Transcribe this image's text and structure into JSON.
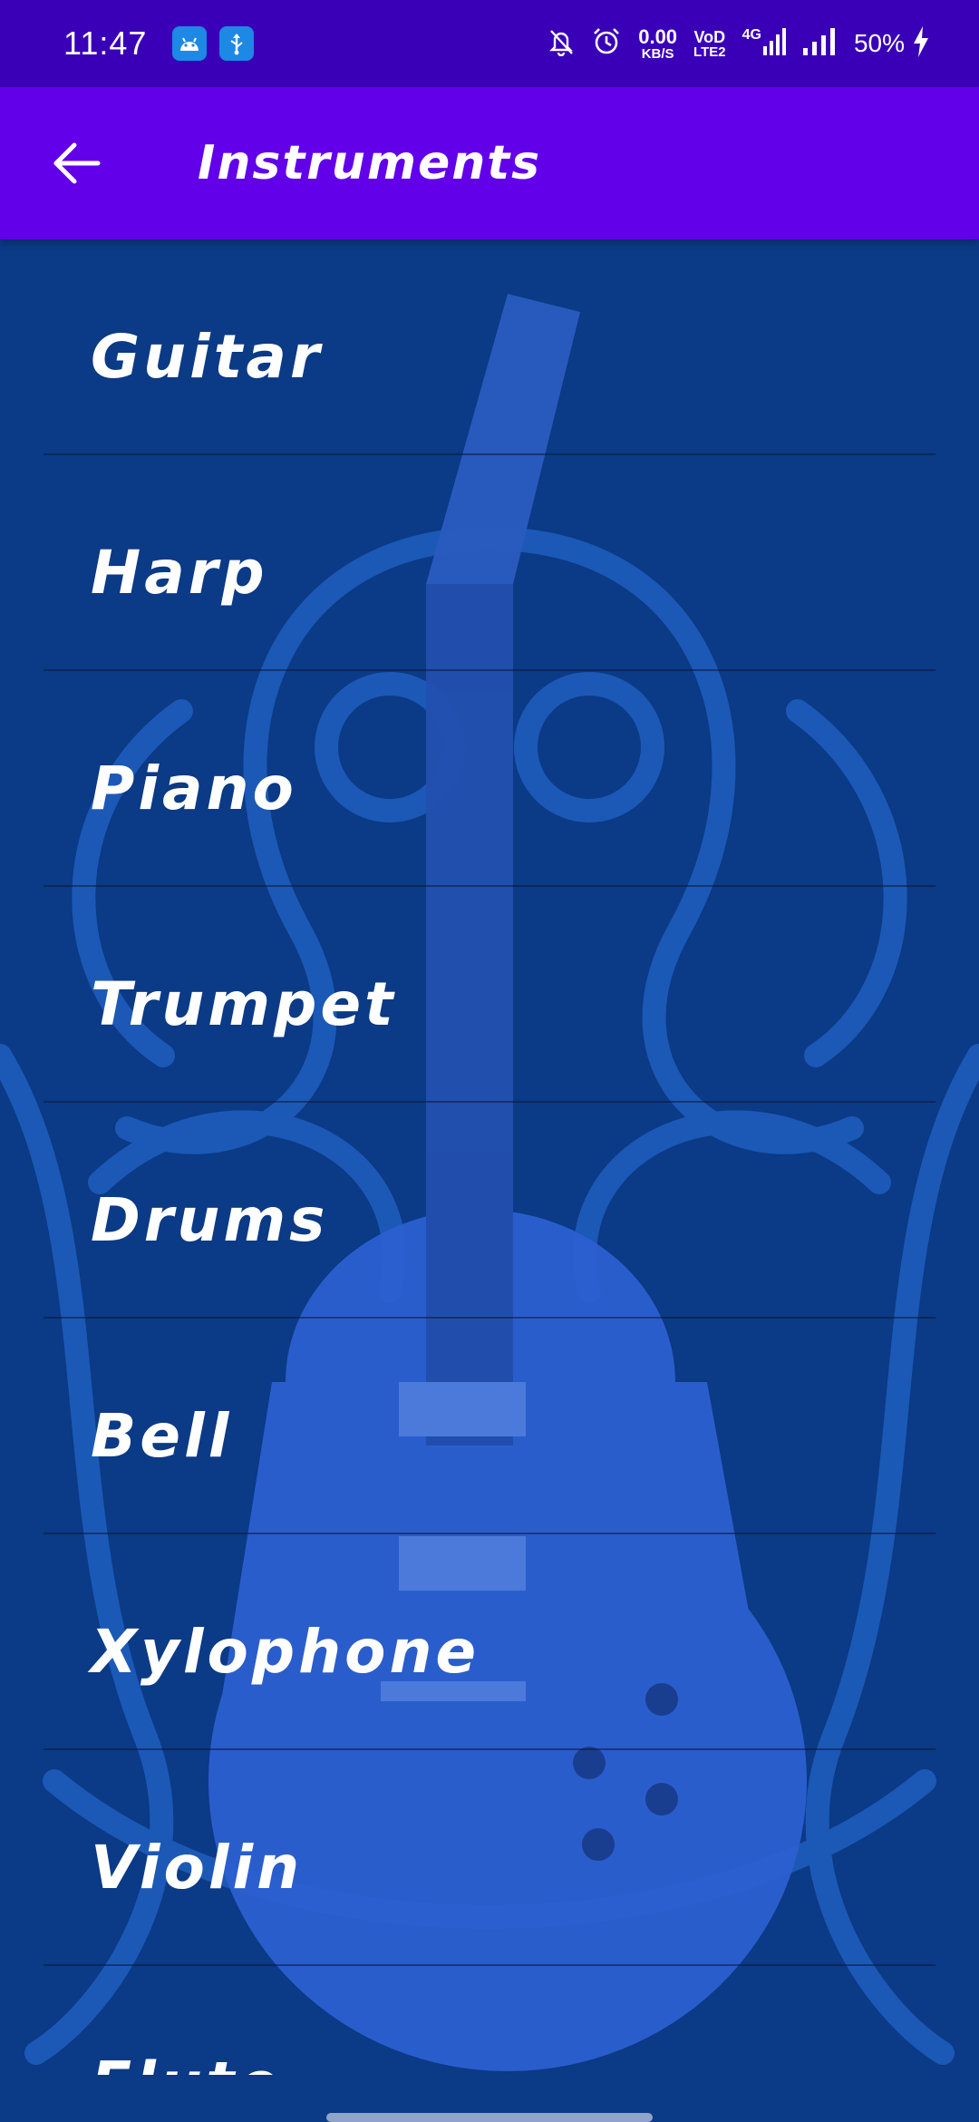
{
  "status_bar": {
    "time": "11:47",
    "net_speed_value": "0.00",
    "net_speed_unit": "KB/S",
    "volte_top": "VoD",
    "volte_bottom": "LTE2",
    "network_type": "4G",
    "battery": "50%",
    "icons": [
      "android-icon",
      "usb-icon",
      "mute-bell-icon",
      "alarm-icon",
      "signal-icon",
      "signal-icon",
      "charging-icon"
    ]
  },
  "app_bar": {
    "back_icon": "arrow-left-icon",
    "title": "Instruments",
    "color": "#6200ea"
  },
  "instruments": [
    {
      "label": "Guitar"
    },
    {
      "label": "Harp"
    },
    {
      "label": "Piano"
    },
    {
      "label": "Trumpet"
    },
    {
      "label": "Drums"
    },
    {
      "label": "Bell"
    },
    {
      "label": "Xylophone"
    },
    {
      "label": "Violin"
    },
    {
      "label": "Flute"
    }
  ],
  "colors": {
    "status_bar": "#3a00b8",
    "background": "#0b3a86",
    "text": "#ffffff"
  }
}
